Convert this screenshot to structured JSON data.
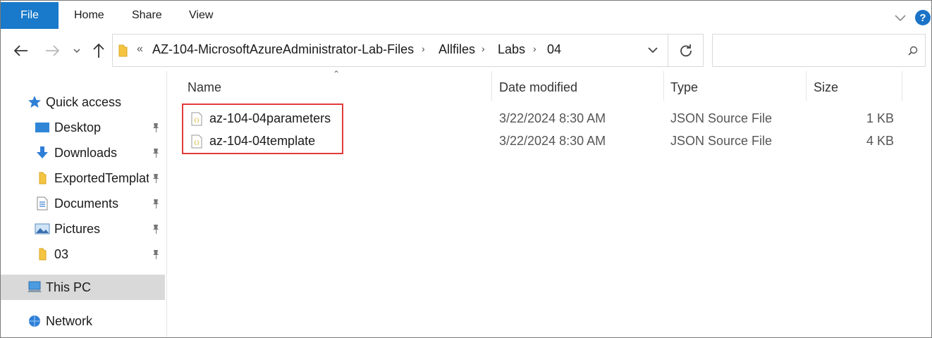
{
  "ribbon": {
    "tabs": [
      "File",
      "Home",
      "Share",
      "View"
    ],
    "help_label": "?"
  },
  "address": {
    "overflow": "«",
    "crumbs": [
      "AZ-104-MicrosoftAzureAdministrator-Lab-Files",
      "Allfiles",
      "Labs",
      "04"
    ],
    "separator": "›"
  },
  "search": {
    "placeholder": ""
  },
  "sidebar": {
    "quick_access": "Quick access",
    "items": [
      {
        "label": "Desktop",
        "icon": "desktop-icon",
        "pinned": true
      },
      {
        "label": "Downloads",
        "icon": "downloads-icon",
        "pinned": true
      },
      {
        "label": "ExportedTemplat",
        "icon": "folder-icon",
        "pinned": true
      },
      {
        "label": "Documents",
        "icon": "documents-icon",
        "pinned": true
      },
      {
        "label": "Pictures",
        "icon": "pictures-icon",
        "pinned": true
      },
      {
        "label": "03",
        "icon": "folder-icon",
        "pinned": true
      }
    ],
    "this_pc": "This PC",
    "network": "Network"
  },
  "columns": [
    "Name",
    "Date modified",
    "Type",
    "Size"
  ],
  "files": [
    {
      "name": "az-104-04parameters",
      "date": "3/22/2024 8:30 AM",
      "type": "JSON Source File",
      "size": "1 KB"
    },
    {
      "name": "az-104-04template",
      "date": "3/22/2024 8:30 AM",
      "type": "JSON Source File",
      "size": "4 KB"
    }
  ],
  "colors": {
    "accent": "#1979ca",
    "highlight": "#e23b3b",
    "selected": "#d9d9d9"
  }
}
